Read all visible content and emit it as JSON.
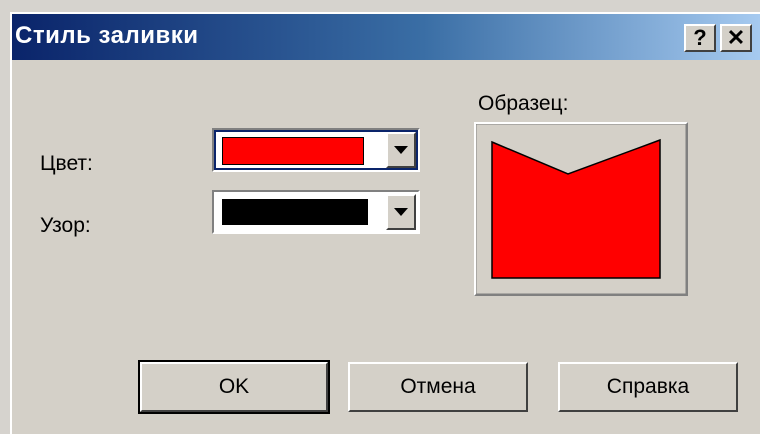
{
  "dialog": {
    "title": "Стиль заливки",
    "help_button": "?",
    "close_button": "✕"
  },
  "fields": {
    "color_label": "Цвет:",
    "color_value": "#ff0000",
    "pattern_label": "Узор:",
    "pattern_value": "#000000"
  },
  "preview": {
    "label": "Образец:",
    "fill_color": "#ff0000"
  },
  "buttons": {
    "ok": "OK",
    "cancel": "Отмена",
    "help": "Справка"
  },
  "colors": {
    "title_start": "#0a246a",
    "title_end": "#a6caf0",
    "dialog_bg": "#d4d0c8"
  }
}
